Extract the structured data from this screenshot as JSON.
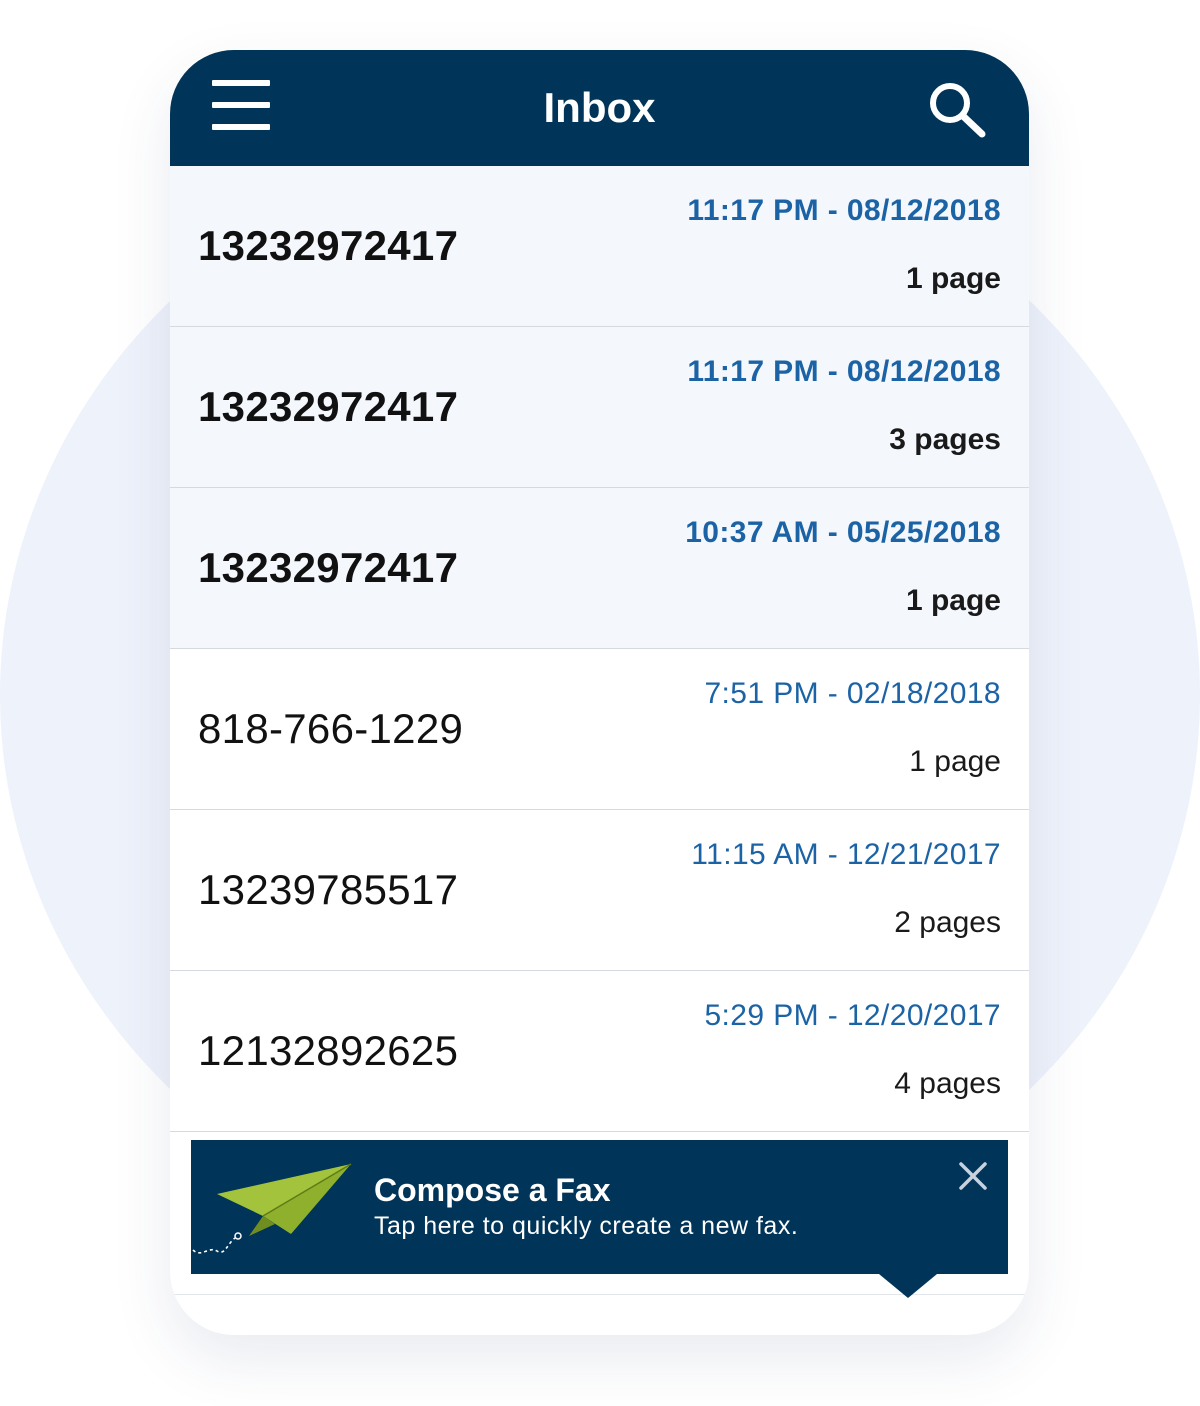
{
  "header": {
    "title": "Inbox",
    "menu_icon": "hamburger-menu-icon",
    "search_icon": "search-icon",
    "color": "#003459"
  },
  "faxes": [
    {
      "sender": "13232972417",
      "datetime": "11:17 PM - 08/12/2018",
      "pages": "1 page",
      "unread": true
    },
    {
      "sender": "13232972417",
      "datetime": "11:17 PM - 08/12/2018",
      "pages": "3 pages",
      "unread": true
    },
    {
      "sender": "13232972417",
      "datetime": "10:37 AM - 05/25/2018",
      "pages": "1 page",
      "unread": true
    },
    {
      "sender": "818-766-1229",
      "datetime": "7:51 PM - 02/18/2018",
      "pages": "1 page",
      "unread": false
    },
    {
      "sender": "13239785517",
      "datetime": "11:15 AM - 12/21/2017",
      "pages": "2 pages",
      "unread": false
    },
    {
      "sender": "12132892625",
      "datetime": "5:29 PM - 12/20/2017",
      "pages": "4 pages",
      "unread": false
    }
  ],
  "compose_banner": {
    "title": "Compose a Fax",
    "subtitle": "Tap here to quickly create a new fax.",
    "icon": "paper-plane-icon",
    "close_icon": "close-icon",
    "background": "#003459",
    "plane_color": "#a3c33c"
  },
  "colors": {
    "datetime": "#1c63a5",
    "unread_row_bg": "#f4f8fd",
    "backdrop": "#eef2fb"
  }
}
